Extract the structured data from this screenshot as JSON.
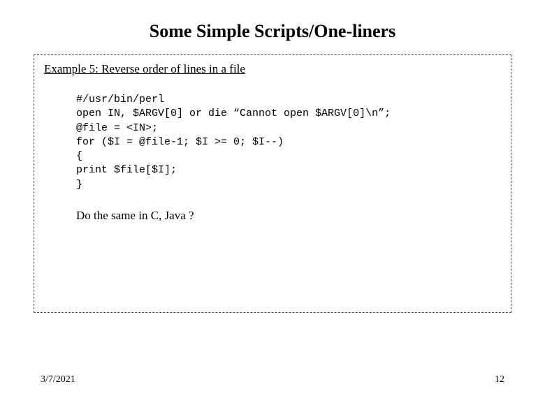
{
  "title": "Some Simple Scripts/One-liners",
  "example_title": "Example 5: Reverse order of lines in a file",
  "code": "#/usr/bin/perl\nopen IN, $ARGV[0] or die “Cannot open $ARGV[0]\\n”;\n@file = <IN>;\nfor ($I = @file-1; $I >= 0; $I--)\n{\nprint $file[$I];\n}",
  "question": "Do the same in C, Java ?",
  "footer_date": "3/7/2021",
  "footer_page": "12"
}
